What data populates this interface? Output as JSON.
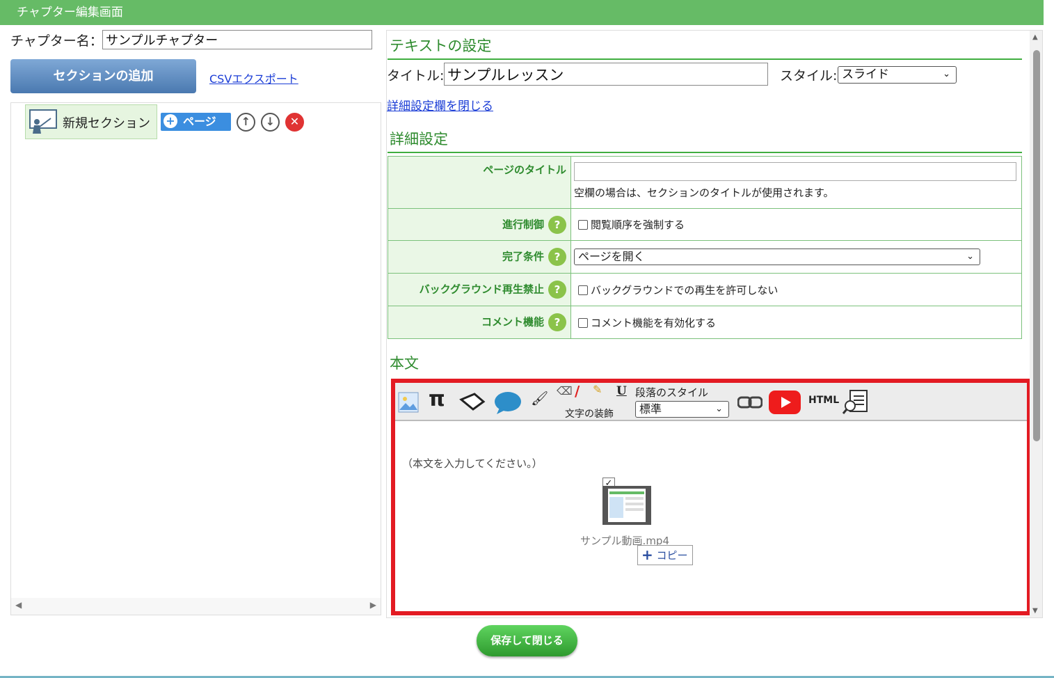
{
  "header": {
    "title": "チャプター編集画面"
  },
  "chapter": {
    "name_label": "チャプター名：",
    "name_value": "サンプルチャプター"
  },
  "left": {
    "add_section_label": "セクションの追加",
    "csv_export_label": "CSVエクスポート",
    "section": {
      "name": "新規セクション",
      "add_page_label": "ページ"
    }
  },
  "text_settings": {
    "heading": "テキストの設定",
    "title_label": "タイトル:",
    "title_value": "サンプルレッスン",
    "style_label": "スタイル:",
    "style_value": "スライド",
    "close_detail_link": "詳細設定欄を閉じる"
  },
  "detail": {
    "heading": "詳細設定",
    "rows": [
      {
        "label": "ページのタイトル",
        "input_value": "",
        "note": "空欄の場合は、セクションのタイトルが使用されます。"
      },
      {
        "label": "進行制御",
        "checkbox_label": "閲覧順序を強制する"
      },
      {
        "label": "完了条件",
        "select_value": "ページを開く"
      },
      {
        "label": "バックグラウンド再生禁止",
        "checkbox_label": "バックグラウンドでの再生を許可しない"
      },
      {
        "label": "コメント機能",
        "checkbox_label": "コメント機能を有効化する"
      }
    ],
    "help_mark": "?"
  },
  "body": {
    "heading": "本文",
    "toolbar": {
      "paragraph_style_label": "段落のスタイル",
      "paragraph_style_value": "標準",
      "text_decoration_label": "文字の装飾",
      "html_label": "HTML"
    },
    "placeholder": "（本文を入力してください。）",
    "video_filename": "サンプル動画.mp4",
    "copy_label": "コピー"
  },
  "save_close_label": "保存して閉じる",
  "colors": {
    "title_bar": "#66bb66",
    "accent_green": "#2e8b2e",
    "highlight_red": "#e31b23"
  }
}
